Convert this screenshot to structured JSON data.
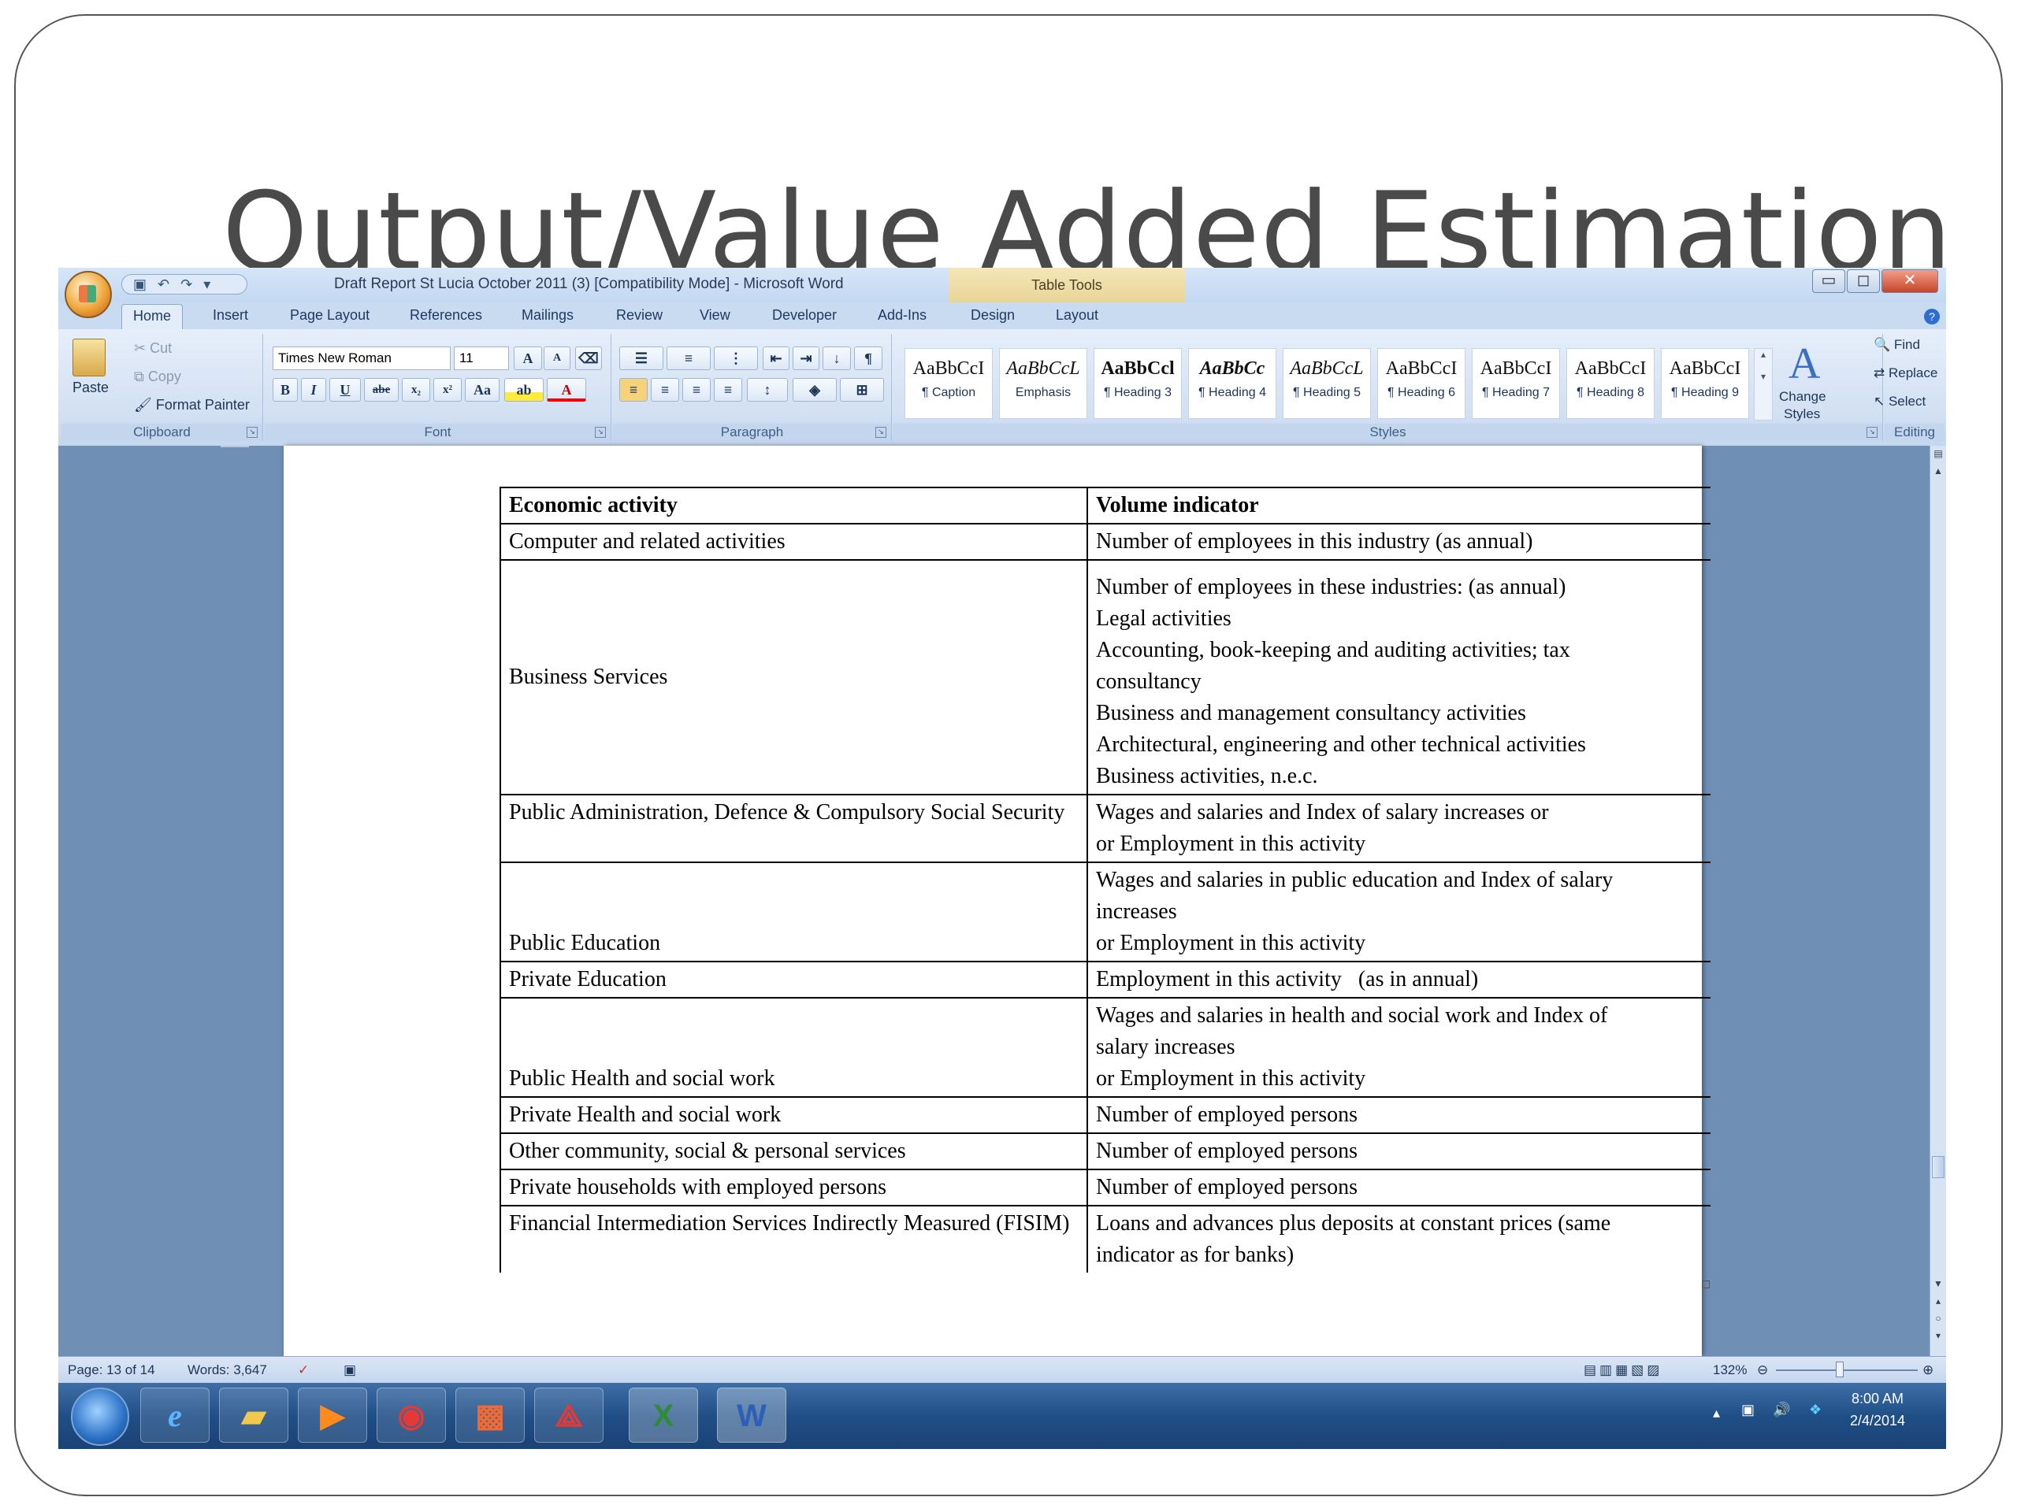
{
  "slide": {
    "title": "Output/Value Added Estimation"
  },
  "window": {
    "title": "Draft Report St Lucia October 2011 (3) [Compatibility Mode] - Microsoft Word",
    "context_tab_group": "Table Tools",
    "controls": {
      "minimize": "▭",
      "maximize": "◻",
      "close": "✕"
    }
  },
  "ribbon": {
    "tabs": [
      "Home",
      "Insert",
      "Page Layout",
      "References",
      "Mailings",
      "Review",
      "View",
      "Developer",
      "Add-Ins",
      "Design",
      "Layout"
    ],
    "clipboard": {
      "paste": "Paste",
      "cut": "Cut",
      "copy": "Copy",
      "format_painter": "Format Painter",
      "label": "Clipboard"
    },
    "font": {
      "font_name": "Times New Roman",
      "font_size": "11",
      "label": "Font",
      "bold": "B",
      "italic": "I",
      "underline": "U",
      "strike": "abe",
      "subscript": "x₂",
      "superscript": "x²",
      "change_case": "Aa",
      "grow": "A",
      "shrink": "A"
    },
    "paragraph": {
      "label": "Paragraph"
    },
    "styles": {
      "label": "Styles",
      "items": [
        {
          "sample": "AaBbCcI",
          "name": "¶ Caption"
        },
        {
          "sample": "AaBbCcL",
          "name": "Emphasis"
        },
        {
          "sample": "AaBbCcl",
          "name": "¶ Heading 3"
        },
        {
          "sample": "AaBbCc",
          "name": "¶ Heading 4"
        },
        {
          "sample": "AaBbCcL",
          "name": "¶ Heading 5"
        },
        {
          "sample": "AaBbCcI",
          "name": "¶ Heading 6"
        },
        {
          "sample": "AaBbCcI",
          "name": "¶ Heading 7"
        },
        {
          "sample": "AaBbCcI",
          "name": "¶ Heading 8"
        },
        {
          "sample": "AaBbCcI",
          "name": "¶ Heading 9"
        }
      ],
      "change_styles_1": "Change",
      "change_styles_2": "Styles"
    },
    "editing": {
      "label": "Editing",
      "find": "Find",
      "replace": "Replace",
      "select": "Select"
    }
  },
  "document": {
    "table": {
      "headers": [
        "Economic activity",
        "Volume indicator"
      ],
      "rows": [
        {
          "activity": "Computer and related activities",
          "indicator": [
            "Number of employees in this industry (as annual)"
          ]
        },
        {
          "activity": "Business Services",
          "indicator": [
            "Number of employees in these industries: (as annual)",
            "Legal activities",
            "Accounting, book-keeping and auditing activities; tax",
            "consultancy",
            "Business and management consultancy activities",
            "Architectural, engineering and other technical activities",
            "Business activities, n.e.c."
          ]
        },
        {
          "activity": "Public Administration, Defence & Compulsory Social Security",
          "indicator": [
            "Wages and salaries and Index of salary increases or",
            "or Employment in this activity"
          ]
        },
        {
          "activity": "Public Education",
          "indicator": [
            "Wages and salaries in public education and Index of salary",
            "increases",
            "or Employment in this activity"
          ]
        },
        {
          "activity": "Private Education",
          "indicator": [
            "Employment in this activity   (as in annual)"
          ]
        },
        {
          "activity": "Public Health and social work",
          "indicator": [
            "Wages and salaries in health and social work and Index of",
            "salary increases",
            "or Employment in this activity"
          ]
        },
        {
          "activity": "Private Health and social work",
          "indicator": [
            "Number of employed persons"
          ]
        },
        {
          "activity": "Other community, social & personal services",
          "indicator": [
            "Number of employed persons"
          ]
        },
        {
          "activity": "Private households with employed persons",
          "indicator": [
            "Number of employed persons"
          ]
        },
        {
          "activity": "Financial Intermediation Services Indirectly Measured (FISIM)",
          "indicator": [
            "Loans and advances plus deposits at constant prices (same",
            "indicator as for banks)"
          ]
        }
      ]
    }
  },
  "statusbar": {
    "page": "Page: 13 of 14",
    "words": "Words: 3,647",
    "zoom": "132%"
  },
  "taskbar": {
    "time": "8:00 AM",
    "date": "2/4/2014"
  }
}
